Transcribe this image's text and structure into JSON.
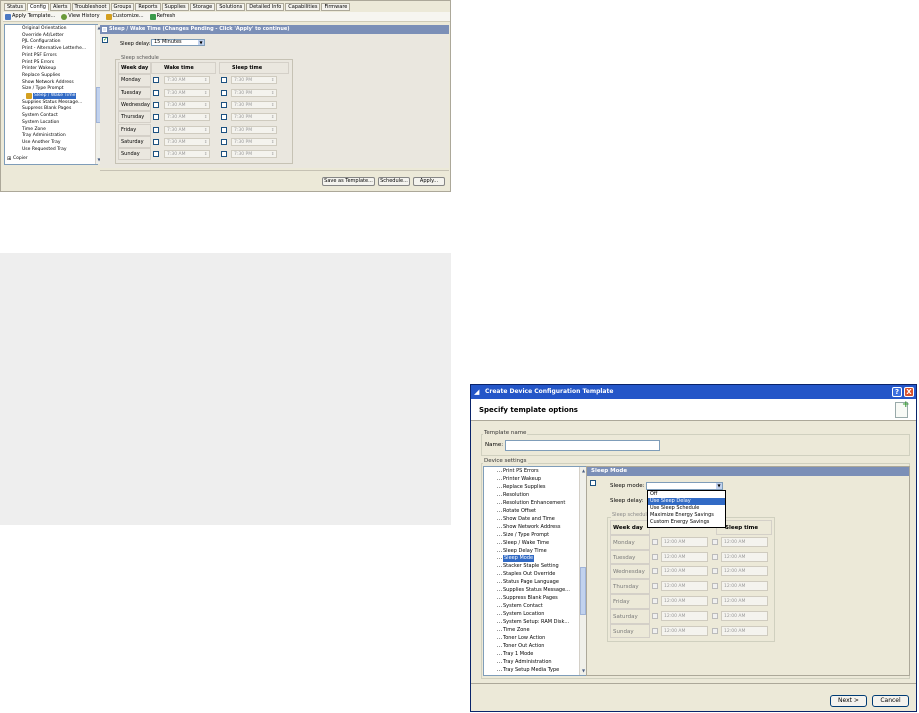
{
  "panel1": {
    "tabs": [
      "Status",
      "Config",
      "Alerts",
      "Troubleshoot",
      "Groups",
      "Reports",
      "Supplies",
      "Storage",
      "Solutions",
      "Detailed Info",
      "Capabilities",
      "Firmware"
    ],
    "active_tab": "Config",
    "toolbar": {
      "apply_template": "Apply Template...",
      "view_history": "View History",
      "customize": "Customize...",
      "refresh": "Refresh"
    },
    "tree_items": [
      "Original Orientation",
      "Override A4/Letter",
      "PJL Configuration",
      "Print - Alternative Letterhe...",
      "Print PSF Errors",
      "Print PS Errors",
      "Printer Wakeup",
      "Replace Supplies",
      "Show Network Address",
      "Size / Type Prompt",
      "Sleep / Wake Time",
      "Supplies Status Message...",
      "Suppress Blank Pages",
      "System Contact",
      "System Location",
      "Time Zone",
      "Tray Administration",
      "Use Another Tray",
      "Use Requested Tray"
    ],
    "selected_item": "Sleep / Wake Time",
    "copier": "Copier",
    "header": "Sleep / Wake Time (Changes Pending - Click 'Apply' to continue)",
    "sleep_delay_label": "Sleep delay:",
    "sleep_delay_value": "15 Minutes",
    "group_label": "Sleep schedule",
    "col_weekday": "Week day",
    "col_wake": "Wake time",
    "col_sleep": "Sleep time",
    "days": [
      "Monday",
      "Tuesday",
      "Wednesday",
      "Thursday",
      "Friday",
      "Saturday",
      "Sunday"
    ],
    "wake_time": "7:30 AM",
    "sleep_time": "7:30 PM",
    "buttons": {
      "save_template": "Save as Template...",
      "schedule": "Schedule...",
      "apply": "Apply..."
    }
  },
  "panel3": {
    "title": "Create Device Configuration Template",
    "subtitle": "Specify template options",
    "template_name_group": "Template name",
    "name_label": "Name:",
    "name_value": "",
    "device_settings_group": "Device settings",
    "tree_items": [
      "Print PS Errors",
      "Printer Wakeup",
      "Replace Supplies",
      "Resolution",
      "Resolution Enhancement",
      "Rotate Offset",
      "Show Date and Time",
      "Show Network Address",
      "Size / Type Prompt",
      "Sleep / Wake Time",
      "Sleep Delay Time",
      "Sleep Mode",
      "Stacker Staple Setting",
      "Staples Out Override",
      "Status Page Language",
      "Supplies Status Message...",
      "Suppress Blank Pages",
      "System Contact",
      "System Location",
      "System Setup: RAM Disk...",
      "Time Zone",
      "Toner Low Action",
      "Toner Out Action",
      "Tray 1 Mode",
      "Tray Administration",
      "Tray Setup Media Type"
    ],
    "selected_item": "Sleep Mode",
    "header": "Sleep Mode",
    "sleep_mode_label": "Sleep mode:",
    "sleep_delay_label": "Sleep delay:",
    "dropdown_options": [
      "Off",
      "Use Sleep Delay",
      "Use Sleep Schedule",
      "Maximize Energy Savings",
      "Custom Energy Savings"
    ],
    "dropdown_selected": "Use Sleep Delay",
    "group_label": "Sleep schedule",
    "col_weekday": "Week day",
    "col_sleep": "Sleep time",
    "days": [
      "Monday",
      "Tuesday",
      "Wednesday",
      "Thursday",
      "Friday",
      "Saturday",
      "Sunday"
    ],
    "time_value": "12:00 AM",
    "buttons": {
      "next": "Next >",
      "cancel": "Cancel"
    },
    "title_buttons": {
      "help": "?",
      "close": "X"
    }
  },
  "colors": {
    "title_blue": "#2456c8",
    "section_header": "#7b8fb7",
    "selection": "#316ac5",
    "panel_bg": "#ece9d8"
  }
}
